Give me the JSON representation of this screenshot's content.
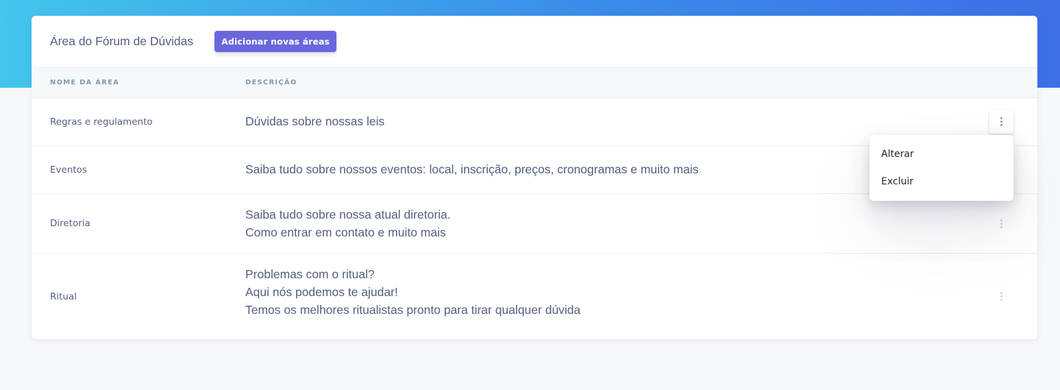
{
  "header": {
    "title": "Área do Fórum de Dúvidas",
    "add_button_label": "Adicionar novas áreas"
  },
  "table": {
    "columns": [
      "NOME DA ÁREA",
      "DESCRIÇÃO"
    ],
    "rows": [
      {
        "name": "Regras e regulamento",
        "description": [
          "Dúvidas sobre nossas leis"
        ]
      },
      {
        "name": "Eventos",
        "description": [
          "Saiba tudo sobre nossos eventos: local, inscrição, preços, cronogramas e muito mais"
        ]
      },
      {
        "name": "Diretoria",
        "description": [
          "Saiba tudo sobre nossa atual diretoria.",
          "Como entrar em contato e muito mais"
        ]
      },
      {
        "name": "Ritual",
        "description": [
          "Problemas com o ritual?",
          "Aqui nós podemos te ajudar!",
          "Temos os melhores ritualistas pronto para tirar qualquer dúvida"
        ]
      }
    ]
  },
  "dropdown": {
    "items": [
      "Alterar",
      "Excluir"
    ]
  },
  "icons": {
    "row_actions": "more-vertical-icon"
  },
  "colors": {
    "gradient_start": "#43c5ec",
    "gradient_end": "#3d6fe6",
    "primary_button": "#6a67de",
    "text": "#525f7f",
    "header_muted": "#8898aa"
  }
}
